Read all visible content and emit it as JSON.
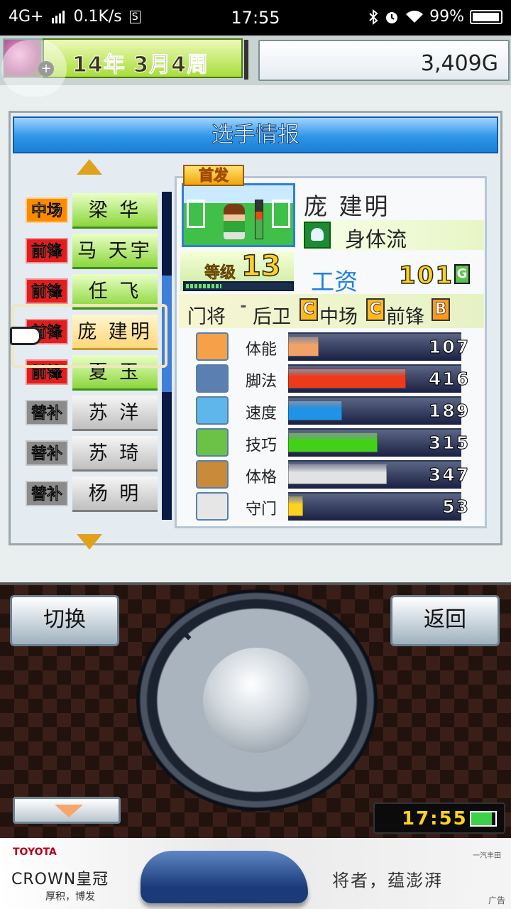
{
  "status_bar": {
    "network": "4G+",
    "speed": "0.1K/s",
    "s_badge": "S",
    "time": "17:55",
    "battery": "99%"
  },
  "header": {
    "date": "14年 3月4周",
    "money": "3,409G"
  },
  "panel": {
    "title": "选手情报"
  },
  "players": [
    {
      "position": "中场",
      "name": "梁 华",
      "pos_color": "orange",
      "status": "starter"
    },
    {
      "position": "前锋",
      "name": "马 天宇",
      "pos_color": "red",
      "status": "starter"
    },
    {
      "position": "前锋",
      "name": "任 飞",
      "pos_color": "red",
      "status": "starter"
    },
    {
      "position": "前锋",
      "name": "庞 建明",
      "pos_color": "red",
      "status": "selected"
    },
    {
      "position": "前锋",
      "name": "夏 玉",
      "pos_color": "red",
      "status": "starter"
    },
    {
      "position": "替补",
      "name": "苏 洋",
      "pos_color": "gray",
      "status": "sub"
    },
    {
      "position": "替补",
      "name": "苏 琦",
      "pos_color": "gray",
      "status": "sub"
    },
    {
      "position": "替补",
      "name": "杨 明",
      "pos_color": "gray",
      "status": "sub"
    }
  ],
  "detail": {
    "badge": "首发",
    "name": "庞 建明",
    "style": "身体流",
    "level_label": "等级",
    "level": "13",
    "level_progress": 0.33,
    "salary_label": "工资",
    "salary": "101",
    "salary_unit": "G",
    "aptitude": [
      {
        "label": "门将",
        "grade": "-"
      },
      {
        "label": "后卫",
        "grade": "C"
      },
      {
        "label": "中场",
        "grade": "C"
      },
      {
        "label": "前锋",
        "grade": "B"
      }
    ],
    "stats": [
      {
        "label": "体能",
        "value": 107,
        "color": "#f2a266",
        "icon": "battery-icon",
        "icon_bg": "#f6a04a"
      },
      {
        "label": "脚法",
        "value": 416,
        "color": "#ee3a1a",
        "icon": "boot-icon",
        "icon_bg": "#5b7fb0"
      },
      {
        "label": "速度",
        "value": 189,
        "color": "#1f93e8",
        "icon": "runner-icon",
        "icon_bg": "#5fb6ea"
      },
      {
        "label": "技巧",
        "value": 315,
        "color": "#42d018",
        "icon": "dribble-icon",
        "icon_bg": "#6bc246"
      },
      {
        "label": "体格",
        "value": 347,
        "color": "#e2e2e2",
        "icon": "muscle-icon",
        "icon_bg": "#c98a3a"
      },
      {
        "label": "守门",
        "value": 53,
        "color": "#ffd21f",
        "icon": "glove-icon",
        "icon_bg": "#e6e6e6"
      }
    ],
    "stat_max": 600
  },
  "controls": {
    "switch_label": "切换",
    "back_label": "返回",
    "clock": "17:55"
  },
  "ad": {
    "brand": "TOYOTA",
    "model": "CROWN皇冠",
    "tagline": "厚积，博发",
    "slogan": "将者，蕴澎湃",
    "corner": "广告",
    "top_right": "一汽丰田"
  }
}
